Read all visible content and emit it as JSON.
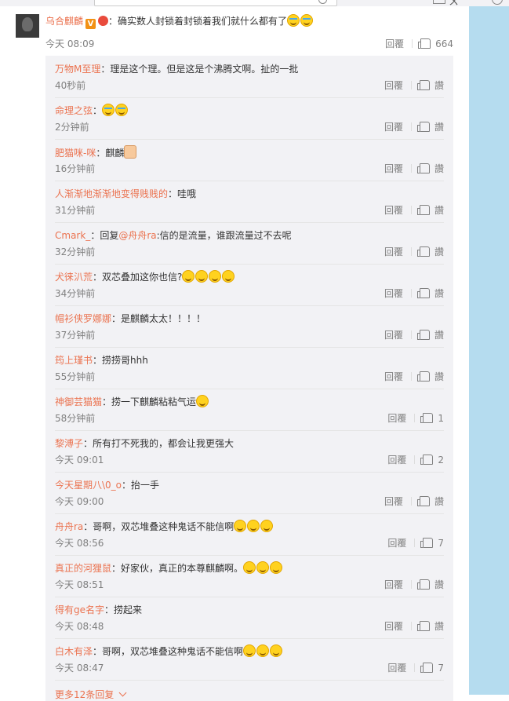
{
  "topbar": {
    "text": "ㄨ"
  },
  "top_comment": {
    "user": "乌合麒麟",
    "text": "：确实数人封锁着封锁着我们就什么都有了",
    "time": "今天 08:09",
    "reply": "回覆",
    "likes": "664"
  },
  "subs": [
    {
      "user": "万物M至理",
      "text": "：理是这个理。但是这是个沸腾文啊。扯的一批",
      "time": "40秒前",
      "reply": "回覆",
      "likes": "讚",
      "emoji": []
    },
    {
      "user": "命理之弦",
      "text": "：",
      "time": "2分钟前",
      "reply": "回覆",
      "likes": "讚",
      "emoji": [
        "laugh-cry-emoji",
        "laugh-cry-emoji"
      ]
    },
    {
      "user": "肥猫咪-咪",
      "text": "：麒麟",
      "time": "16分钟前",
      "reply": "回覆",
      "likes": "讚",
      "emoji": [
        "thumbs-up-emoji"
      ]
    },
    {
      "user": "人渐渐地渐渐地变得贱贱的",
      "text": "：哇哦",
      "time": "31分钟前",
      "reply": "回覆",
      "likes": "讚",
      "emoji": []
    },
    {
      "user": "Cmark_",
      "text": "：回复",
      "mention": "@舟舟ra",
      "text2": ":信的是流量，谁跟流量过不去呢",
      "time": "32分钟前",
      "reply": "回覆",
      "likes": "讚",
      "emoji": []
    },
    {
      "user": "犬徕汃荒",
      "text": "：双芯叠加这你也信?",
      "time": "34分钟前",
      "reply": "回覆",
      "likes": "讚",
      "emoji": [
        "smile-emoji",
        "smile-emoji",
        "smile-emoji",
        "smile-emoji"
      ]
    },
    {
      "user": "帽衫侠罗娜娜",
      "text": "：是麒麟太太！！！！",
      "time": "37分钟前",
      "reply": "回覆",
      "likes": "讚",
      "emoji": []
    },
    {
      "user": "筠上瑾书",
      "text": "：捞捞哥hhh",
      "time": "55分钟前",
      "reply": "回覆",
      "likes": "讚",
      "emoji": []
    },
    {
      "user": "神御芸猫猫",
      "text": "：捞一下麒麟粘粘气运",
      "time": "58分钟前",
      "reply": "回覆",
      "likes": "1",
      "emoji": [
        "grin-emoji"
      ]
    },
    {
      "user": "黎溥子",
      "text": "：所有打不死我的，都会让我更强大",
      "time": "今天 09:01",
      "reply": "回覆",
      "likes": "2",
      "emoji": []
    },
    {
      "user": "今天星期八\\0_o",
      "text": "：抬一手",
      "time": "今天 09:00",
      "reply": "回覆",
      "likes": "讚",
      "emoji": []
    },
    {
      "user": "舟舟ra",
      "text": "：哥啊，双芯堆叠这种鬼话不能信啊",
      "time": "今天 08:56",
      "reply": "回覆",
      "likes": "7",
      "emoji": [
        "smile-emoji",
        "smile-emoji",
        "smile-emoji"
      ]
    },
    {
      "user": "真正的河狸鼠",
      "text": "：好家伙，真正的本尊麒麟啊。",
      "time": "今天 08:51",
      "reply": "回覆",
      "likes": "讚",
      "emoji": [
        "doge-emoji",
        "doge-emoji",
        "doge-emoji"
      ]
    },
    {
      "user": "得有ge名字",
      "text": "：捞起来",
      "time": "今天 08:48",
      "reply": "回覆",
      "likes": "讚",
      "emoji": []
    },
    {
      "user": "白木有泽",
      "text": "：哥啊，双芯堆叠这种鬼话不能信啊",
      "time": "今天 08:47",
      "reply": "回覆",
      "likes": "7",
      "emoji": [
        "smile-emoji",
        "smile-emoji",
        "smile-emoji"
      ]
    }
  ],
  "more": "更多12条回复"
}
